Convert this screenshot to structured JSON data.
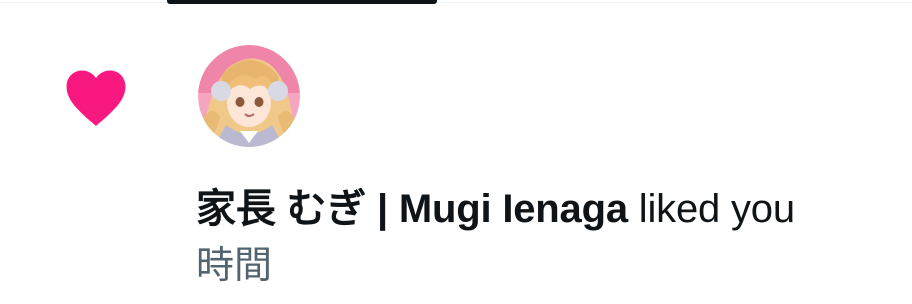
{
  "notification": {
    "type": "like",
    "icon": "heart-icon",
    "accent_color": "#f91880",
    "avatar": "user-avatar",
    "user_name": "家長 むぎ | Mugi Ienaga",
    "action_text": " liked you",
    "timestamp": "時間"
  },
  "colors": {
    "text_primary": "#0f1419",
    "text_secondary": "#536471"
  }
}
